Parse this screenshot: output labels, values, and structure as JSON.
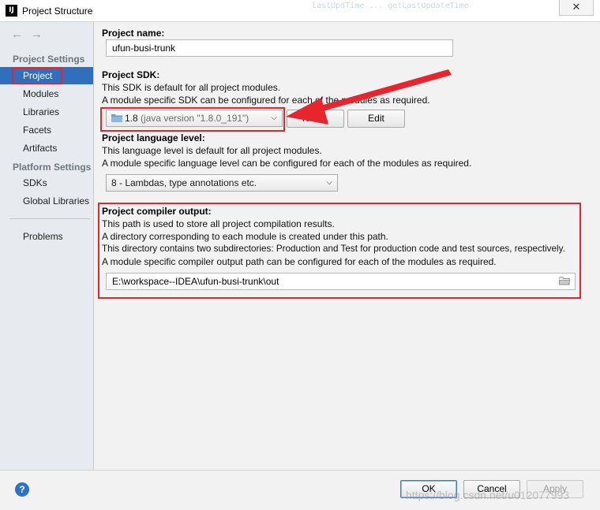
{
  "window": {
    "app_icon": "IJ",
    "title": "Project Structure",
    "close_glyph": "✕",
    "bg_code": "lastUpdTime    ...  getLastUpdateTime"
  },
  "sidebar": {
    "back_icon": "←",
    "forward_icon": "→",
    "project_settings_header": "Project Settings",
    "project_settings_items": [
      {
        "label": "Project",
        "selected": true
      },
      {
        "label": "Modules"
      },
      {
        "label": "Libraries"
      },
      {
        "label": "Facets"
      },
      {
        "label": "Artifacts"
      }
    ],
    "platform_settings_header": "Platform Settings",
    "platform_settings_items": [
      {
        "label": "SDKs"
      },
      {
        "label": "Global Libraries"
      }
    ],
    "problems_label": "Problems"
  },
  "main": {
    "project_name": {
      "label": "Project name:",
      "value": "ufun-busi-trunk"
    },
    "project_sdk": {
      "label": "Project SDK:",
      "desc1": "This SDK is default for all project modules.",
      "desc2": "A module specific SDK can be configured for each of the modules as required.",
      "selected_version": "1.8",
      "selected_detail": "(java version \"1.8.0_191\")",
      "new_button": "New...",
      "edit_button": "Edit"
    },
    "language_level": {
      "label": "Project language level:",
      "desc1": "This language level is default for all project modules.",
      "desc2": "A module specific language level can be configured for each of the modules as required.",
      "selected": "8 - Lambdas, type annotations etc."
    },
    "compiler_output": {
      "label": "Project compiler output:",
      "desc1": "This path is used to store all project compilation results.",
      "desc2": "A directory corresponding to each module is created under this path.",
      "desc3": "This directory contains two subdirectories: Production and Test for production code and test sources, respectively.",
      "desc4": "A module specific compiler output path can be configured for each of the modules as required.",
      "path": "E:\\workspace--IDEA\\ufun-busi-trunk\\out"
    }
  },
  "footer": {
    "help_icon": "?",
    "ok_button": "OK",
    "cancel_button": "Cancel",
    "apply_button": "Apply",
    "watermark": "https://blog.csdn.net/u012077993"
  },
  "colors": {
    "selection": "#2f6fbe",
    "annotation_red": "#e8252d",
    "sidebar_bg": "#e7ebf0",
    "content_bg": "#f2f2f2"
  }
}
